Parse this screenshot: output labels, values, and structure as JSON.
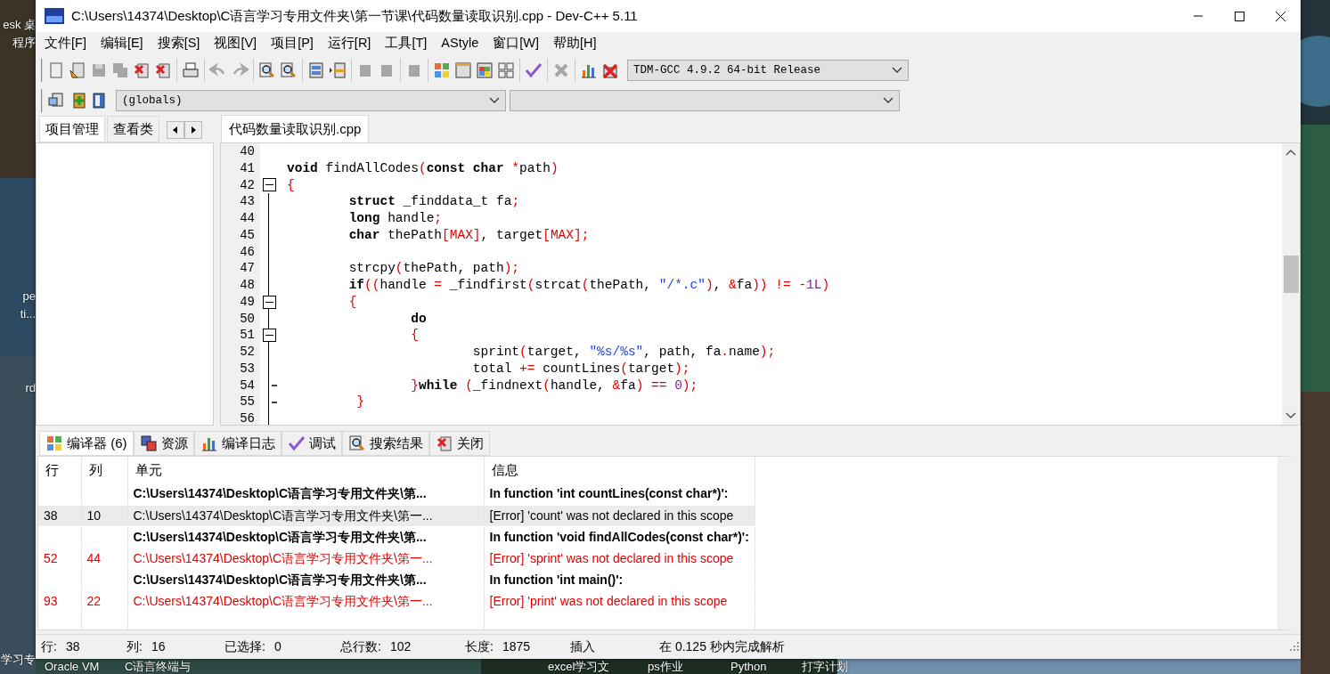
{
  "desktop": {
    "left_labels": [
      "esk 桌",
      "程序",
      "pe",
      "ti...",
      "rd",
      "学习专"
    ],
    "bottom_labels": [
      "Oracle VM",
      "C语言终端与",
      "excel学习文",
      "ps作业",
      "Python",
      "打字计划"
    ]
  },
  "window": {
    "title": "C:\\Users\\14374\\Desktop\\C语言学习专用文件夹\\第一节课\\代码数量读取识别.cpp - Dev-C++ 5.11"
  },
  "menu": [
    "文件[F]",
    "编辑[E]",
    "搜索[S]",
    "视图[V]",
    "项目[P]",
    "运行[R]",
    "工具[T]",
    "AStyle",
    "窗口[W]",
    "帮助[H]"
  ],
  "toolbars": [
    {
      "groups": [
        [
          {
            "kind": "new",
            "disabled": false
          },
          {
            "kind": "open",
            "disabled": false
          },
          {
            "kind": "save",
            "disabled": true
          },
          {
            "kind": "saveall",
            "disabled": true
          },
          {
            "kind": "close",
            "disabled": false
          },
          {
            "kind": "closeall",
            "disabled": false
          }
        ],
        [
          {
            "kind": "print",
            "disabled": false
          }
        ],
        [
          {
            "kind": "undo",
            "disabled": true
          },
          {
            "kind": "redo",
            "disabled": true
          }
        ],
        [
          {
            "kind": "find",
            "disabled": false
          },
          {
            "kind": "replace",
            "disabled": false
          }
        ],
        [
          {
            "kind": "panel",
            "disabled": false
          },
          {
            "kind": "goto",
            "disabled": false
          }
        ],
        [
          {
            "kind": "bmprev",
            "disabled": true
          },
          {
            "kind": "bmnext",
            "disabled": true
          }
        ],
        [
          {
            "kind": "bookmark",
            "disabled": true
          }
        ],
        [
          {
            "kind": "compile",
            "disabled": false
          },
          {
            "kind": "run",
            "disabled": false
          },
          {
            "kind": "compilerun",
            "disabled": false
          },
          {
            "kind": "rebuild",
            "disabled": false
          }
        ],
        [
          {
            "kind": "check",
            "disabled": false
          }
        ],
        [
          {
            "kind": "stop",
            "disabled": true
          }
        ],
        [
          {
            "kind": "chart",
            "disabled": false
          },
          {
            "kind": "chartdel",
            "disabled": false
          }
        ]
      ],
      "dropdowns": [
        {
          "value": "TDM-GCC 4.9.2 64-bit Release"
        }
      ]
    },
    {
      "groups": [
        [
          {
            "kind": "newclass",
            "disabled": false
          },
          {
            "kind": "addfile",
            "disabled": false
          },
          {
            "kind": "book",
            "disabled": false
          }
        ]
      ],
      "dropdowns": [
        {
          "value": "(globals)"
        }
      ]
    }
  ],
  "side_tabs": [
    {
      "label": "项目管理",
      "selected": true
    },
    {
      "label": "查看类",
      "selected": false
    }
  ],
  "editor_tabs": [
    {
      "label": "代码数量读取识别.cpp",
      "selected": true
    }
  ],
  "code": [
    {
      "number": "40"
    },
    {
      "number": "41",
      "tokens": [
        {
          "kind": "kw",
          "text": "void"
        },
        {
          "kind": "p",
          "text": " findAllCodes"
        },
        {
          "kind": "s",
          "text": "("
        },
        {
          "kind": "kw",
          "text": "const char"
        },
        {
          "kind": "s",
          "text": " *"
        },
        {
          "kind": "p",
          "text": "path"
        },
        {
          "kind": "s",
          "text": ")"
        }
      ]
    },
    {
      "number": "42",
      "fold_start": true,
      "tokens": [
        {
          "kind": "s",
          "text": "{"
        }
      ]
    },
    {
      "number": "43",
      "tokens": [
        {
          "kind": "kw",
          "text": "\tstruct"
        },
        {
          "kind": "p",
          "text": " _finddata_t fa"
        },
        {
          "kind": "s",
          "text": ";"
        }
      ]
    },
    {
      "number": "44",
      "tokens": [
        {
          "kind": "kw",
          "text": "\tlong"
        },
        {
          "kind": "p",
          "text": " handle"
        },
        {
          "kind": "s",
          "text": ";"
        }
      ]
    },
    {
      "number": "45",
      "tokens": [
        {
          "kind": "kw",
          "text": "\tchar"
        },
        {
          "kind": "p",
          "text": " thePath"
        },
        {
          "kind": "s",
          "text": "[MAX]"
        },
        {
          "kind": "p",
          "text": ", target"
        },
        {
          "kind": "s",
          "text": "[MAX];"
        }
      ]
    },
    {
      "number": "46"
    },
    {
      "number": "47",
      "tokens": [
        {
          "kind": "p",
          "text": "\tstrcpy"
        },
        {
          "kind": "s",
          "text": "("
        },
        {
          "kind": "p",
          "text": "thePath, path"
        },
        {
          "kind": "s",
          "text": ");"
        }
      ]
    },
    {
      "number": "48",
      "tokens": [
        {
          "kind": "kw",
          "text": "\tif"
        },
        {
          "kind": "s",
          "text": "(("
        },
        {
          "kind": "p",
          "text": "handle "
        },
        {
          "kind": "s",
          "text": "="
        },
        {
          "kind": "p",
          "text": " _findfirst"
        },
        {
          "kind": "s",
          "text": "("
        },
        {
          "kind": "p",
          "text": "strcat"
        },
        {
          "kind": "s",
          "text": "("
        },
        {
          "kind": "p",
          "text": "thePath, "
        },
        {
          "kind": "str",
          "text": "\"/*.c\""
        },
        {
          "kind": "s",
          "text": ")"
        },
        {
          "kind": "p",
          "text": ", "
        },
        {
          "kind": "s",
          "text": "&"
        },
        {
          "kind": "p",
          "text": "fa"
        },
        {
          "kind": "s",
          "text": ")) != -"
        },
        {
          "kind": "num",
          "text": "1L"
        },
        {
          "kind": "s",
          "text": ")"
        }
      ]
    },
    {
      "number": "49",
      "fold_start": true,
      "tokens": [
        {
          "kind": "s",
          "text": "\t{"
        }
      ]
    },
    {
      "number": "50",
      "tokens": [
        {
          "kind": "kw",
          "text": "\t\tdo"
        }
      ]
    },
    {
      "number": "51",
      "fold_start": true,
      "tokens": [
        {
          "kind": "s",
          "text": "\t\t{"
        }
      ]
    },
    {
      "number": "52",
      "tokens": [
        {
          "kind": "p",
          "text": "\t\t\tsprint"
        },
        {
          "kind": "s",
          "text": "("
        },
        {
          "kind": "p",
          "text": "target, "
        },
        {
          "kind": "str",
          "text": "\"%s/%s\""
        },
        {
          "kind": "p",
          "text": ", path, fa"
        },
        {
          "kind": "s",
          "text": "."
        },
        {
          "kind": "p",
          "text": "name"
        },
        {
          "kind": "s",
          "text": ");"
        }
      ]
    },
    {
      "number": "53",
      "tokens": [
        {
          "kind": "p",
          "text": "\t\t\ttotal "
        },
        {
          "kind": "s",
          "text": "+="
        },
        {
          "kind": "p",
          "text": " countLines"
        },
        {
          "kind": "s",
          "text": "("
        },
        {
          "kind": "p",
          "text": "target"
        },
        {
          "kind": "s",
          "text": ");"
        }
      ]
    },
    {
      "number": "54",
      "fold_end": true,
      "tokens": [
        {
          "kind": "s",
          "text": "\t\t}"
        },
        {
          "kind": "kw",
          "text": "while"
        },
        {
          "kind": "s",
          "text": " ("
        },
        {
          "kind": "p",
          "text": "_findnext"
        },
        {
          "kind": "s",
          "text": "("
        },
        {
          "kind": "p",
          "text": "handle, "
        },
        {
          "kind": "s",
          "text": "&"
        },
        {
          "kind": "p",
          "text": "fa"
        },
        {
          "kind": "s",
          "text": ") == "
        },
        {
          "kind": "num",
          "text": "0"
        },
        {
          "kind": "s",
          "text": ");"
        }
      ]
    },
    {
      "number": "55",
      "fold_end": true,
      "tokens": [
        {
          "kind": "s",
          "text": "\t }"
        }
      ]
    },
    {
      "number": "56"
    }
  ],
  "bottom_tabs": [
    {
      "label": "编译器 (6)",
      "kind": "compile",
      "selected": true
    },
    {
      "label": "资源",
      "kind": "resource",
      "selected": false
    },
    {
      "label": "编译日志",
      "kind": "chart",
      "selected": false
    },
    {
      "label": "调试",
      "kind": "check",
      "selected": false
    },
    {
      "label": "搜索结果",
      "kind": "find",
      "selected": false
    },
    {
      "label": "关闭",
      "kind": "close",
      "selected": false
    }
  ],
  "table": {
    "columns": [
      "行",
      "列",
      "单元",
      "信息"
    ],
    "rows": [
      {
        "kind": "header",
        "selected": false,
        "unit": "C:\\Users\\14374\\Desktop\\C语言学习专用文件夹\\第...",
        "message": "In function 'int countLines(const char*)':"
      },
      {
        "kind": "error",
        "selected": true,
        "line": "38",
        "col": "10",
        "unit": "C:\\Users\\14374\\Desktop\\C语言学习专用文件夹\\第一...",
        "message": "[Error] 'count' was not declared in this scope"
      },
      {
        "kind": "header",
        "selected": false,
        "unit": "C:\\Users\\14374\\Desktop\\C语言学习专用文件夹\\第...",
        "message": "In function 'void findAllCodes(const char*)':"
      },
      {
        "kind": "error",
        "selected": false,
        "line": "52",
        "col": "44",
        "unit": "C:\\Users\\14374\\Desktop\\C语言学习专用文件夹\\第一...",
        "message": "[Error] 'sprint' was not declared in this scope"
      },
      {
        "kind": "header",
        "selected": false,
        "unit": "C:\\Users\\14374\\Desktop\\C语言学习专用文件夹\\第...",
        "message": "In function 'int main()':"
      },
      {
        "kind": "error",
        "selected": false,
        "line": "93",
        "col": "22",
        "unit": "C:\\Users\\14374\\Desktop\\C语言学习专用文件夹\\第一...",
        "message": "[Error] 'print' was not declared in this scope"
      }
    ]
  },
  "status_bar": [
    {
      "label": "行:",
      "value": "38"
    },
    {
      "label": "列:",
      "value": "16"
    },
    {
      "label": "已选择:",
      "value": "0"
    },
    {
      "label": "总行数:",
      "value": "102"
    },
    {
      "label": "长度:",
      "value": "1875"
    },
    {
      "label": "插入"
    },
    {
      "label": "在 0.125 秒内完成解析"
    }
  ]
}
